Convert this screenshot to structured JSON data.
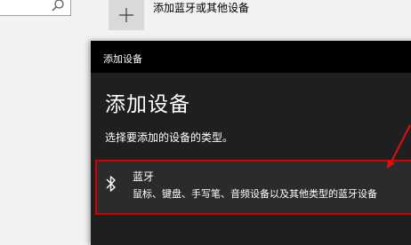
{
  "search": {
    "icon": "search-icon"
  },
  "background_settings": {
    "add_button_icon": "plus-icon",
    "add_label": "添加蓝牙或其他设备"
  },
  "dialog": {
    "title_bar": "添加设备",
    "heading": "添加设备",
    "subtitle": "选择要添加的设备的类型。",
    "options": [
      {
        "icon": "bluetooth-icon",
        "title": "蓝牙",
        "description": "鼠标、键盘、手写笔、音频设备以及其他类型的蓝牙设备"
      }
    ]
  },
  "colors": {
    "dialog_background": "#1f1f1f",
    "title_bar": "#000000",
    "highlight_border": "#d40000",
    "annotation_arrow": "#e01010"
  }
}
